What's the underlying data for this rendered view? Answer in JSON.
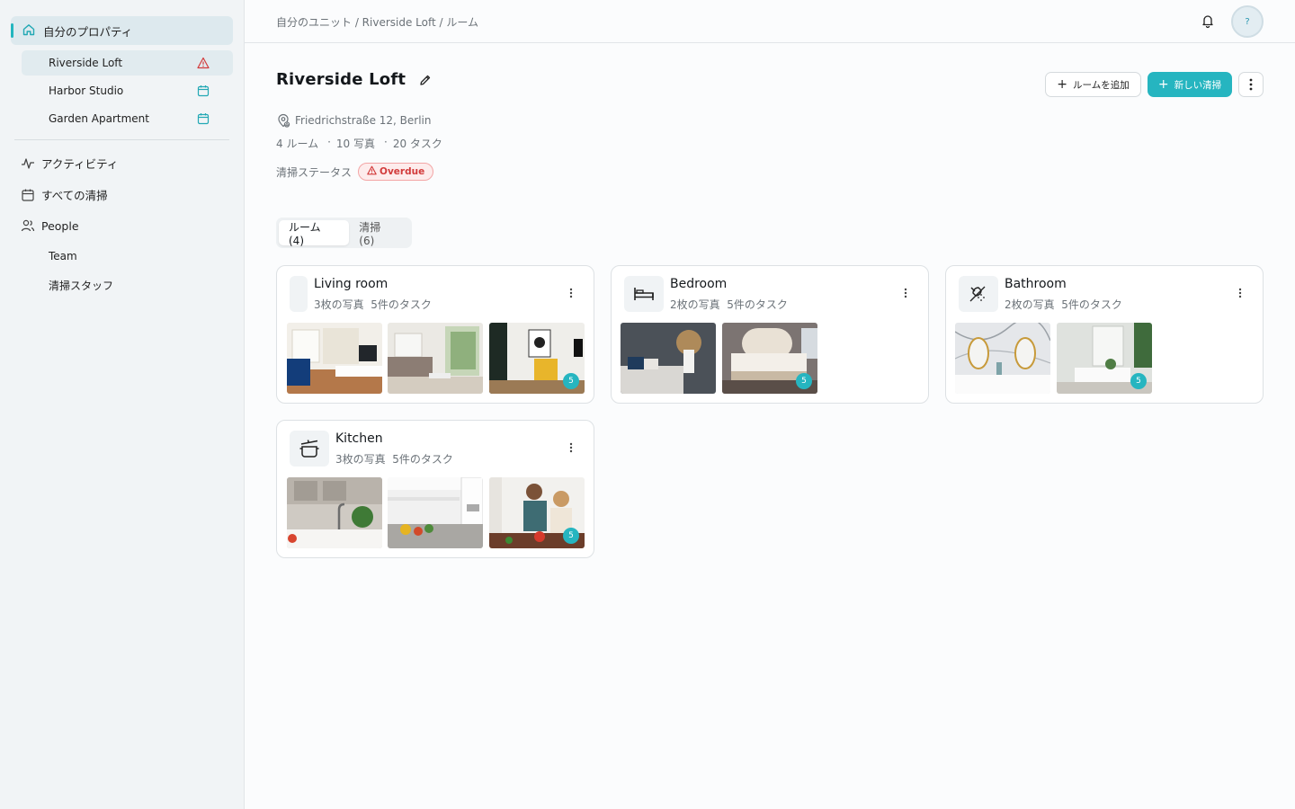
{
  "sidebar": {
    "section_title": "自分のプロパティ",
    "properties": [
      {
        "name": "Riverside Loft",
        "status_icon": "warning-triangle-icon"
      },
      {
        "name": "Harbor Studio",
        "status_icon": "calendar-icon"
      },
      {
        "name": "Garden Apartment",
        "status_icon": "calendar-icon"
      }
    ],
    "activity": "アクティビティ",
    "all_cleanings": "すべての清掃",
    "people": "People",
    "team": "Team",
    "staff": "清掃スタッフ"
  },
  "header": {
    "breadcrumb": "自分のユニット / Riverside Loft / ルーム",
    "avatar_text": "?"
  },
  "property": {
    "title": "Riverside Loft",
    "address": "Friedrichstraße 12, Berlin",
    "rooms": "4 ルーム",
    "photos": "10 写真",
    "tasks": "20 タスク",
    "separator": "·",
    "status_label": "清掃ステータス",
    "status_value": "Overdue"
  },
  "actions": {
    "add_room": "ルームを追加",
    "new_cleaning": "新しい清掃"
  },
  "tabs": [
    {
      "label": "ルーム (4)",
      "active": true
    },
    {
      "label": "清掃 (6)",
      "active": false
    }
  ],
  "rooms": [
    {
      "name": "Living room",
      "photos": "3枚の写真",
      "tasks": "5件のタスク",
      "icon": "blank-icon",
      "badge": "5"
    },
    {
      "name": "Bedroom",
      "photos": "2枚の写真",
      "tasks": "5件のタスク",
      "icon": "bed-icon",
      "badge": "5"
    },
    {
      "name": "Bathroom",
      "photos": "2枚の写真",
      "tasks": "5件のタスク",
      "icon": "shower-icon",
      "badge": "5"
    },
    {
      "name": "Kitchen",
      "photos": "3枚の写真",
      "tasks": "5件のタスク",
      "icon": "cooking-pot-icon",
      "badge": "5"
    }
  ],
  "colors": {
    "accent": "#26b5c0",
    "danger": "#d23b3b"
  }
}
